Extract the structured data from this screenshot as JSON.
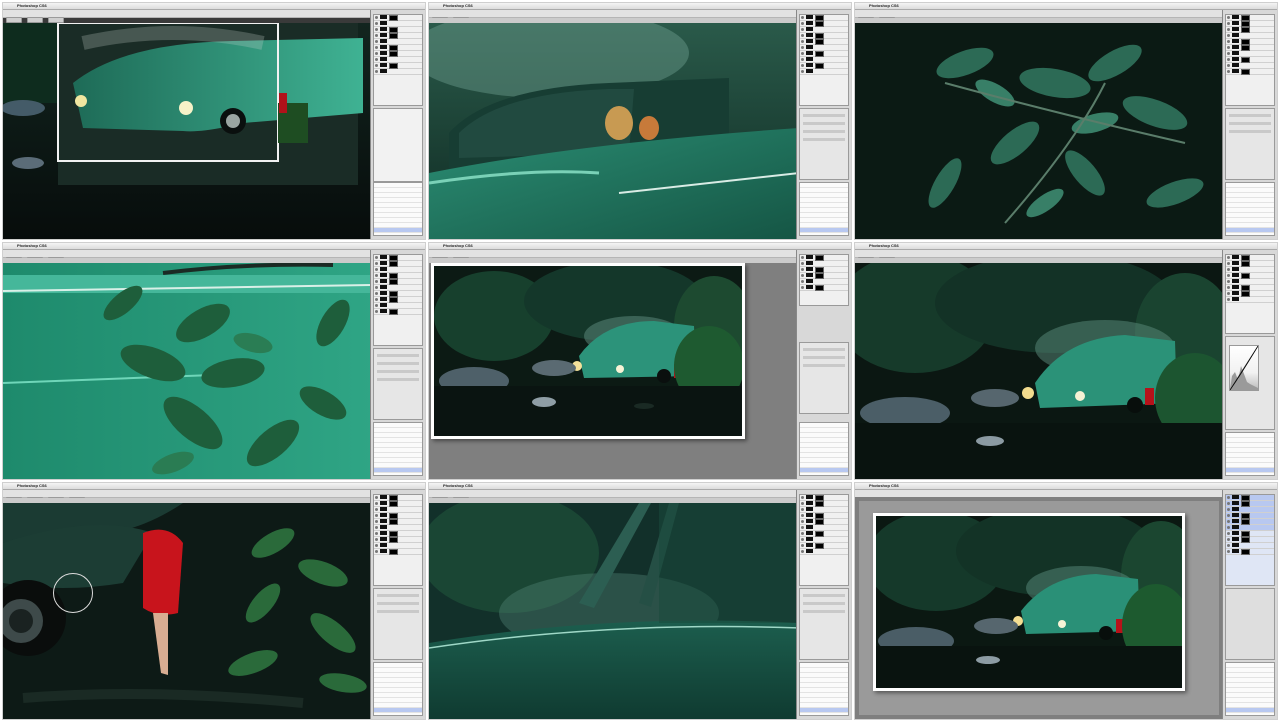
{
  "app": {
    "name": "Photoshop CS6",
    "menu": [
      "File",
      "Edit",
      "Image",
      "Layer",
      "Type",
      "Select",
      "Filter",
      "3D",
      "View",
      "Window",
      "Help"
    ]
  },
  "cells": [
    {
      "id": "1",
      "scene": "car-closeup-with-crop-box"
    },
    {
      "id": "2",
      "scene": "car-interior-driver"
    },
    {
      "id": "3",
      "scene": "leaves-closeup"
    },
    {
      "id": "4",
      "scene": "leaves-over-car-door"
    },
    {
      "id": "5",
      "scene": "full-composite-framed"
    },
    {
      "id": "6",
      "scene": "full-composite-curves"
    },
    {
      "id": "7",
      "scene": "red-dress-brush"
    },
    {
      "id": "8",
      "scene": "windshield-closeup"
    },
    {
      "id": "9",
      "scene": "full-composite-final"
    }
  ],
  "colors": {
    "car_teal": "#2f9a7e",
    "forest_dark": "#0f2a20",
    "water_dark": "#0b1412",
    "dress_red": "#c8141c",
    "panel_gray": "#d8d8d8",
    "history_selected": "#b8c8f0"
  }
}
